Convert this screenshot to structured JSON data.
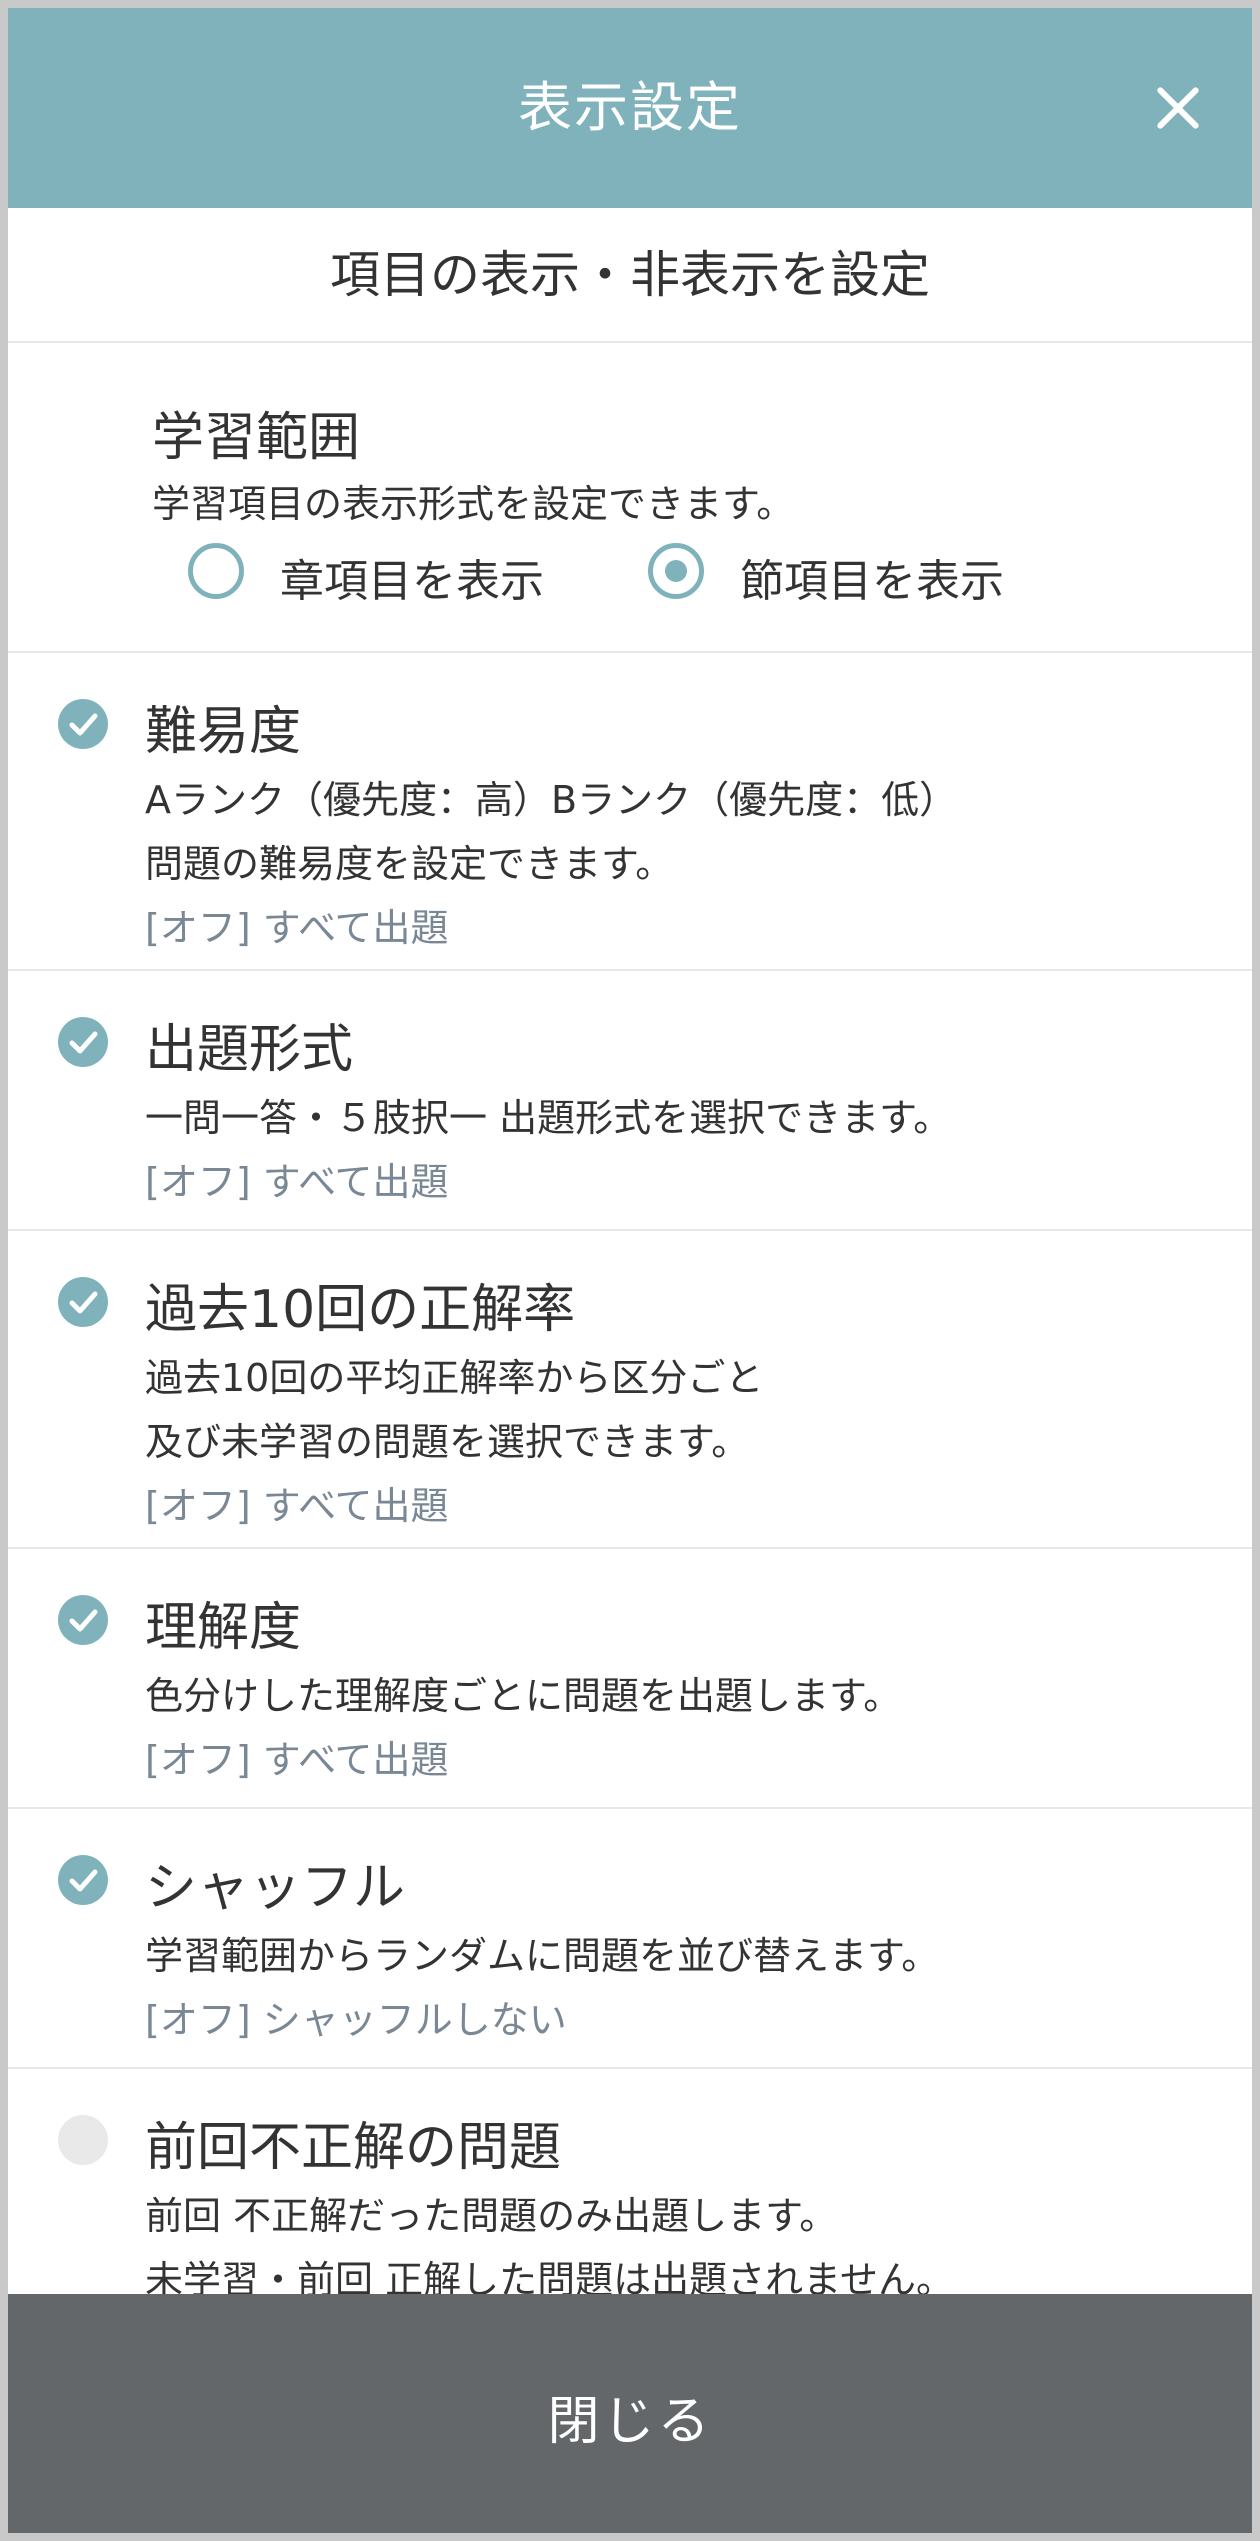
{
  "header": {
    "title": "表示設定",
    "close_icon": "close-icon"
  },
  "subheading": "項目の表示・非表示を設定",
  "scope": {
    "title": "学習範囲",
    "description": "学習項目の表示形式を設定できます。",
    "options": [
      {
        "label": "章項目を表示",
        "selected": false
      },
      {
        "label": "節項目を表示",
        "selected": true
      }
    ]
  },
  "items": [
    {
      "title": "難易度",
      "enabled": true,
      "lines": [
        "Aランク（優先度：高）Bランク（優先度：低）",
        "問題の難易度を設定できます。"
      ],
      "default": "[オフ] すべて出題"
    },
    {
      "title": "出題形式",
      "enabled": true,
      "lines": [
        "一問一答・５肢択一 出題形式を選択できます。"
      ],
      "default": "[オフ] すべて出題"
    },
    {
      "title": "過去10回の正解率",
      "enabled": true,
      "lines": [
        "過去10回の平均正解率から区分ごと",
        "及び未学習の問題を選択できます。"
      ],
      "default": "[オフ] すべて出題"
    },
    {
      "title": "理解度",
      "enabled": true,
      "lines": [
        "色分けした理解度ごとに問題を出題します。"
      ],
      "default": "[オフ] すべて出題"
    },
    {
      "title": "シャッフル",
      "enabled": true,
      "lines": [
        "学習範囲からランダムに問題を並び替えます。"
      ],
      "default": "[オフ] シャッフルしない"
    },
    {
      "title": "前回不正解の問題",
      "enabled": false,
      "lines": [
        "前回 不正解だった問題のみ出題します。",
        "未学習・前回 正解した問題は出題されません。"
      ],
      "default": ""
    }
  ],
  "footer": {
    "close_label": "閉じる"
  },
  "colors": {
    "accent": "#80b2bc",
    "footer": "#636769",
    "muted_text": "#7a8896"
  }
}
